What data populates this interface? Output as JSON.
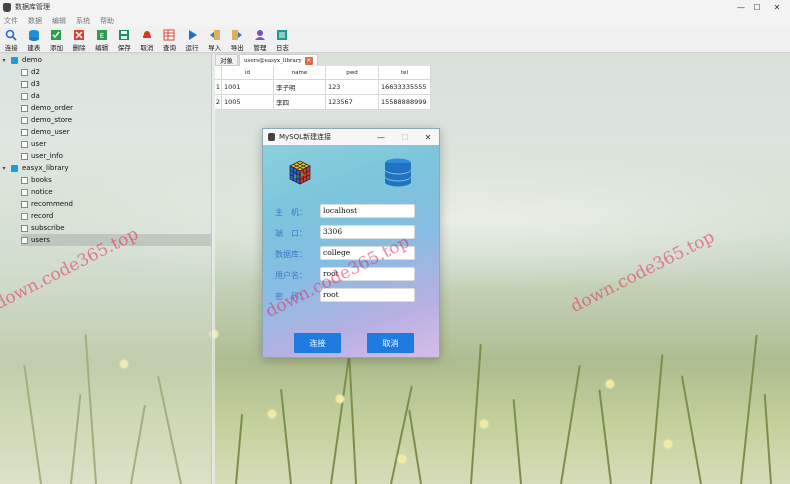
{
  "window": {
    "title": "数据库管理",
    "controls": [
      "—",
      "☐",
      "✕"
    ]
  },
  "menu": [
    "文件",
    "数据",
    "编辑",
    "系统",
    "帮助"
  ],
  "toolbar": [
    {
      "label": "连接",
      "icon": "connect-icon"
    },
    {
      "label": "建表",
      "icon": "create-table-icon"
    },
    {
      "label": "添加",
      "icon": "add-icon"
    },
    {
      "label": "删除",
      "icon": "delete-icon"
    },
    {
      "label": "编辑",
      "icon": "edit-icon"
    },
    {
      "label": "保存",
      "icon": "save-icon"
    },
    {
      "label": "取消",
      "icon": "cancel-icon"
    },
    {
      "label": "查询",
      "icon": "query-icon"
    },
    {
      "label": "运行",
      "icon": "run-icon"
    },
    {
      "label": "导入",
      "icon": "import-icon"
    },
    {
      "label": "导出",
      "icon": "export-icon"
    },
    {
      "label": "管理",
      "icon": "manage-icon"
    },
    {
      "label": "日志",
      "icon": "log-icon"
    }
  ],
  "tree": [
    {
      "name": "demo",
      "tables": [
        "d2",
        "d3",
        "da",
        "demo_order",
        "demo_store",
        "demo_user",
        "user",
        "user_info"
      ]
    },
    {
      "name": "easyx_library",
      "tables": [
        "books",
        "notice",
        "recommend",
        "record",
        "subscribe",
        "users"
      ],
      "selected": "users"
    }
  ],
  "tabs": [
    {
      "label": "对象"
    },
    {
      "label": "users@easyx_library",
      "close": "×"
    }
  ],
  "table": {
    "columns": [
      "id",
      "name",
      "pwd",
      "tel"
    ],
    "rows": [
      {
        "num": "1",
        "id": "1001",
        "name": "李子明",
        "pwd": "123",
        "tel": "16633335555"
      },
      {
        "num": "2",
        "id": "1005",
        "name": "李四",
        "pwd": "123567",
        "tel": "15588888999"
      }
    ]
  },
  "dialog": {
    "title": "MySQL新建连接",
    "controls": [
      "—",
      "☐",
      "✕"
    ],
    "fields": [
      {
        "label": "主　机：",
        "value": "localhost"
      },
      {
        "label": "端　口：",
        "value": "3306"
      },
      {
        "label": "数据库：",
        "value": "college"
      },
      {
        "label": "用户名：",
        "value": "root"
      },
      {
        "label": "密　码：",
        "value": "root"
      }
    ],
    "connect_label": "连接",
    "cancel_label": "取消"
  },
  "watermarks": [
    "down.code365.top",
    "down.code365.top",
    "down.code365.top"
  ]
}
